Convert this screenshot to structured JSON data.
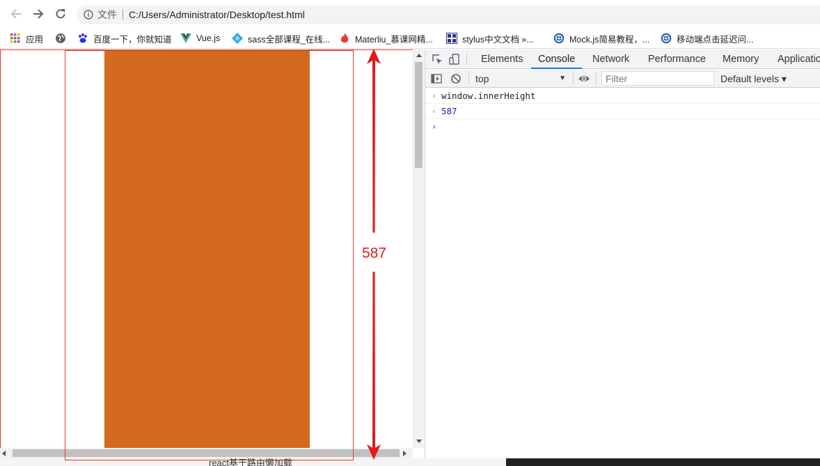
{
  "browser": {
    "file_label": "文件",
    "url": "C:/Users/Administrator/Desktop/test.html"
  },
  "bookmarks": [
    {
      "label": "应用",
      "icon": "apps-grid-icon"
    },
    {
      "label": "",
      "icon": "globe-icon"
    },
    {
      "label": "百度一下，你就知道",
      "icon": "baidu-paw-icon"
    },
    {
      "label": "Vue.js",
      "icon": "vue-logo-icon"
    },
    {
      "label": "sass全部课程_在线...",
      "icon": "sass-diamond-icon"
    },
    {
      "label": "Materliu_慕课网精...",
      "icon": "flame-icon"
    },
    {
      "label": "stylus中文文档 »...",
      "icon": "doc-grid-icon"
    },
    {
      "label": "Mock.js简易教程，...",
      "icon": "mock-globe-icon"
    },
    {
      "label": "移动端点击延迟问...",
      "icon": "mock-globe-icon"
    }
  ],
  "annotation": {
    "label": "587",
    "color": "#e01b1b"
  },
  "page": {
    "block_color": "#d46a1f"
  },
  "devtools": {
    "tabs": [
      "Elements",
      "Console",
      "Network",
      "Performance",
      "Memory",
      "Applicatio"
    ],
    "active_tab": "Console",
    "context": "top",
    "filter_placeholder": "Filter",
    "levels": "Default levels ▾",
    "console": {
      "input": "window.innerHeight",
      "output": "587"
    }
  },
  "background": {
    "text": "react基于路由懒加载"
  }
}
